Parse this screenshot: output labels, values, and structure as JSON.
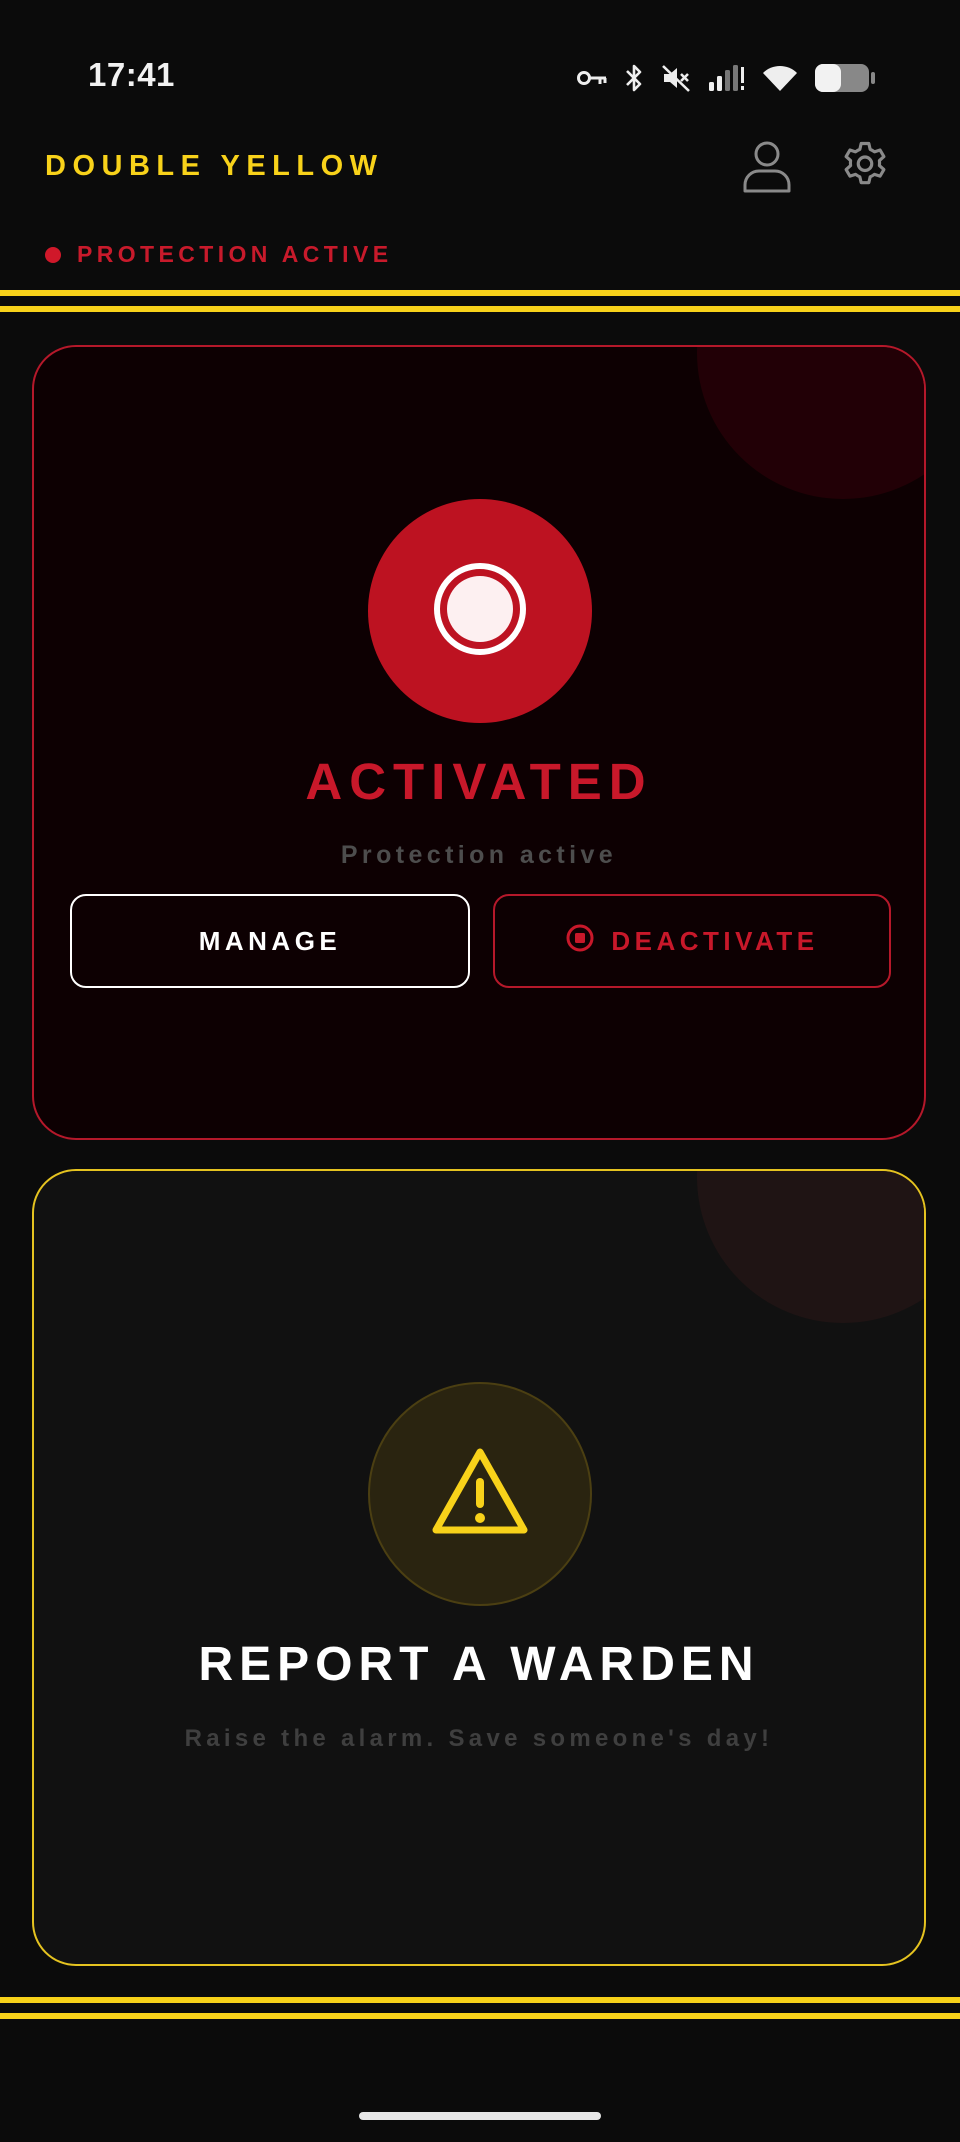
{
  "status_bar": {
    "time": "17:41",
    "icons": [
      "vpn-key-icon",
      "bluetooth-icon",
      "mute-icon",
      "signal-icon",
      "wifi-icon",
      "battery-icon"
    ]
  },
  "header": {
    "app_title": "DOUBLE YELLOW",
    "profile_icon": "user-icon",
    "settings_icon": "gear-icon",
    "protection_status": "PROTECTION ACTIVE"
  },
  "activated_card": {
    "icon": "record-icon",
    "heading": "ACTIVATED",
    "subtext": "Protection active",
    "manage_label": "MANAGE",
    "deactivate_label": "DEACTIVATE",
    "deactivate_icon": "stop-circle-icon"
  },
  "report_card": {
    "icon": "warning-icon",
    "heading": "REPORT A WARDEN",
    "subtext": "Raise the alarm. Save someone's day!"
  },
  "colors": {
    "accent_yellow": "#f8d21a",
    "alert_red": "#c8182a",
    "background": "#0b0b0b"
  }
}
